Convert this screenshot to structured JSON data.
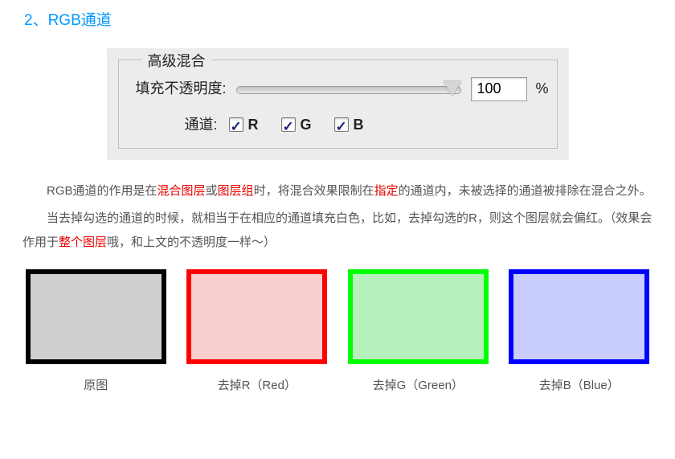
{
  "title": "2、RGB通道",
  "panel": {
    "legend": "高级混合",
    "opacityLabel": "填充不透明度:",
    "opacityValue": "100",
    "percent": "%",
    "channelLabel": "通道:",
    "channels": {
      "r": "R",
      "g": "G",
      "b": "B"
    }
  },
  "para1": {
    "t1": "RGB通道的作用是在",
    "r1": "混合图层",
    "t2": "或",
    "r2": "图层组",
    "t3": "时，将混合效果限制在",
    "r3": "指定",
    "t4": "的通道内，未被选择的通道被排除在混合之外。"
  },
  "para2": {
    "t1": "当去掉勾选的通道的时候，就相当于在相应的通道填充白色，比如，去掉勾选的R，则这个图层就会偏红。（效果会作用于",
    "r1": "整个图层",
    "t2": "哦，和上文的不透明度一样～）"
  },
  "swatches": {
    "orig": "原图",
    "r": "去掉R（Red）",
    "g": "去掉G（Green）",
    "b": "去掉B（Blue）"
  }
}
